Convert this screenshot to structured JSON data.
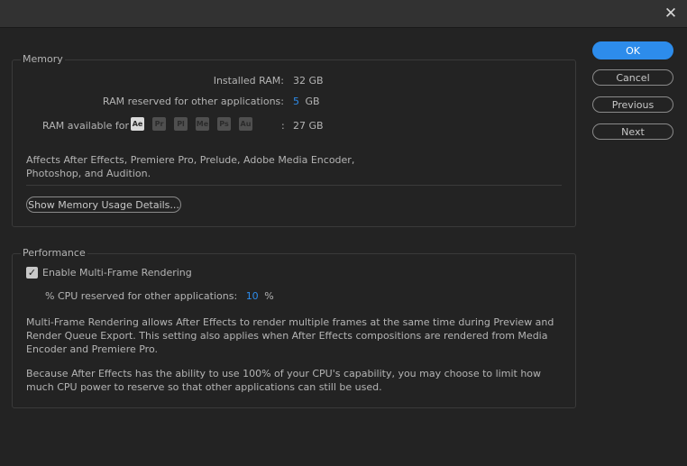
{
  "window": {
    "close_glyph": "✕"
  },
  "memory": {
    "title": "Memory",
    "installed_ram_label": "Installed RAM:",
    "installed_ram_value": "32 GB",
    "reserved_label": "RAM reserved for other applications:",
    "reserved_value": "5",
    "reserved_unit": "GB",
    "available_label": "RAM available for",
    "apps": [
      "Ae",
      "Pr",
      "Pl",
      "Me",
      "Ps",
      "Au"
    ],
    "available_sep": ":",
    "available_value": "27 GB",
    "affects_line1": "Affects After Effects, Premiere Pro, Prelude, Adobe Media Encoder,",
    "affects_line2": "Photoshop, and Audition.",
    "details_button": "Show Memory Usage Details..."
  },
  "performance": {
    "title": "Performance",
    "mfr_checkbox_label": "Enable Multi-Frame Rendering",
    "mfr_checked": true,
    "check_glyph": "✓",
    "cpu_label": "% CPU reserved for other applications:",
    "cpu_value": "10",
    "cpu_unit": "%",
    "desc1_line1": "Multi-Frame Rendering allows After Effects to render multiple frames at the same time during Preview and",
    "desc1_line2": "Render Queue Export. This setting also applies when After Effects compositions are rendered from Media",
    "desc1_line3": "Encoder and Premiere Pro.",
    "desc2_line1": "Because After Effects has the ability to use 100% of your CPU's capability, you may choose to limit how",
    "desc2_line2": "much CPU power to reserve so that other applications can still be used."
  },
  "buttons": {
    "ok": "OK",
    "cancel": "Cancel",
    "previous": "Previous",
    "next": "Next"
  },
  "colors": {
    "accent": "#2d8ceb",
    "background": "#232323",
    "titlebar": "#323232"
  }
}
